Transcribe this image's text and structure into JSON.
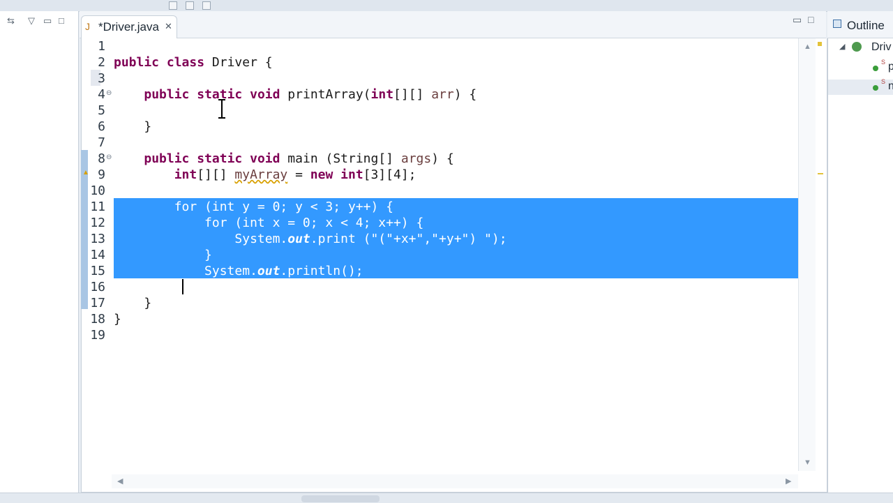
{
  "editor": {
    "tab_title": "*Driver.java",
    "lines": [
      {
        "n": "1",
        "t": ""
      },
      {
        "n": "2",
        "t": "public class Driver {"
      },
      {
        "n": "3",
        "t": ""
      },
      {
        "n": "4",
        "t": "    public static void printArray(int[][] arr) {"
      },
      {
        "n": "5",
        "t": ""
      },
      {
        "n": "6",
        "t": "    }"
      },
      {
        "n": "7",
        "t": ""
      },
      {
        "n": "8",
        "t": "    public static void main (String[] args) {"
      },
      {
        "n": "9",
        "t": "        int[][] myArray = new int[3][4];"
      },
      {
        "n": "10",
        "t": ""
      },
      {
        "n": "11",
        "t": "        for (int y = 0; y < 3; y++) {"
      },
      {
        "n": "12",
        "t": "            for (int x = 0; x < 4; x++) {"
      },
      {
        "n": "13",
        "t": "                System.out.print (\"(\"+x+\",\"+y+\") \");"
      },
      {
        "n": "14",
        "t": "            }"
      },
      {
        "n": "15",
        "t": "            System.out.println();"
      },
      {
        "n": "16",
        "t": "        }"
      },
      {
        "n": "17",
        "t": "    }"
      },
      {
        "n": "18",
        "t": "}"
      },
      {
        "n": "19",
        "t": ""
      }
    ],
    "selected_lines": [
      "11",
      "12",
      "13",
      "14",
      "15",
      "16"
    ]
  },
  "outline": {
    "title": "Outline",
    "items": [
      {
        "label": "Driv"
      },
      {
        "label": "p"
      },
      {
        "label": "n"
      }
    ]
  },
  "colors": {
    "selection": "#3399ff",
    "keyword": "#7f0055",
    "parameter": "#6a3e3e",
    "field": "#0000c0"
  }
}
